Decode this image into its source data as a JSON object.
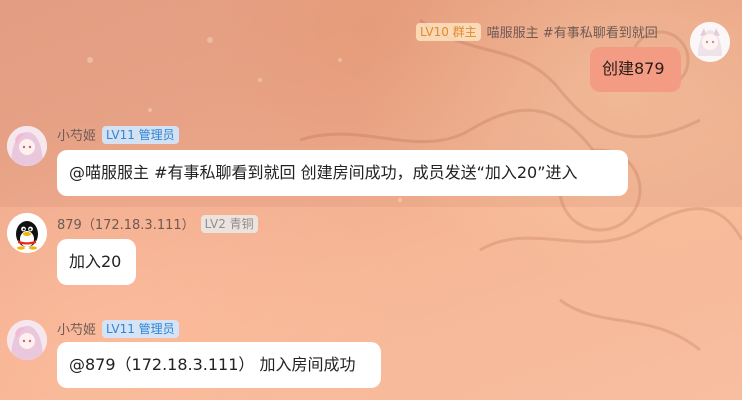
{
  "colors": {
    "self_bubble": "#f49b84",
    "other_bubble": "#ffffff",
    "owner_badge_text": "#e38a2e",
    "admin_badge_text": "#2f86d6",
    "member_badge_text": "#8f8f8f"
  },
  "messages": [
    {
      "side": "right",
      "sender": "喵服服主 #有事私聊看到就回",
      "badge": "LV10 群主",
      "badge_type": "owner",
      "avatar_icon": "anime-girl-avatar-icon",
      "text": "创建879"
    },
    {
      "side": "left",
      "sender": "小芍姬",
      "badge": "LV11 管理员",
      "badge_type": "admin",
      "avatar_icon": "anime-girl-avatar-icon",
      "text": "@喵服服主 #有事私聊看到就回 创建房间成功，成员发送“加入20”进入"
    },
    {
      "side": "left",
      "sender": "879（172.18.3.111）",
      "badge": "LV2 青铜",
      "badge_type": "member",
      "avatar_icon": "qq-penguin-avatar-icon",
      "text": "加入20"
    },
    {
      "side": "left",
      "sender": "小芍姬",
      "badge": "LV11 管理员",
      "badge_type": "admin",
      "avatar_icon": "anime-girl-avatar-icon",
      "text": "@879（172.18.3.111） 加入房间成功"
    }
  ]
}
